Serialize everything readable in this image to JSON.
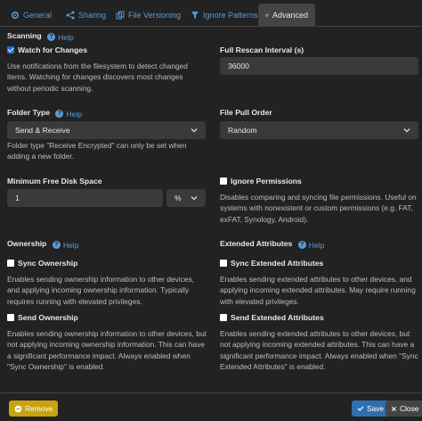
{
  "tabs": [
    {
      "label": "General",
      "icon": "gear-icon"
    },
    {
      "label": "Sharing",
      "icon": "share-icon"
    },
    {
      "label": "File Versioning",
      "icon": "copy-icon"
    },
    {
      "label": "Ignore Patterns",
      "icon": "filter-icon"
    },
    {
      "label": "Advanced",
      "icon": "cogs-icon",
      "active": true
    }
  ],
  "help_label": "Help",
  "scanning": {
    "title": "Scanning",
    "watch_label": "Watch for Changes",
    "watch_checked": true,
    "watch_desc": "Use notifications from the filesystem to detect changed items. Watching for changes discovers most changes without periodic scanning."
  },
  "rescan": {
    "label": "Full Rescan Interval (s)",
    "value": "36000"
  },
  "folder_type": {
    "title": "Folder Type",
    "value": "Send & Receive",
    "desc": "Folder type \"Receive Encrypted\" can only be set when adding a new folder."
  },
  "file_pull_order": {
    "label": "File Pull Order",
    "value": "Random"
  },
  "min_disk": {
    "label": "Minimum Free Disk Space",
    "value": "1",
    "unit": "%"
  },
  "ignore_permissions": {
    "label": "Ignore Permissions",
    "checked": false,
    "desc": "Disables comparing and syncing file permissions. Useful on systems with nonexistent or custom permissions (e.g. FAT, exFAT, Synology, Android)."
  },
  "ownership": {
    "title": "Ownership",
    "sync_label": "Sync Ownership",
    "sync_desc": "Enables sending ownership information to other devices, and applying incoming ownership information. Typically requires running with elevated privileges.",
    "send_label": "Send Ownership",
    "send_desc": "Enables sending ownership information to other devices, but not applying incoming ownership information. This can have a significant performance impact. Always enabled when \"Sync Ownership\" is enabled."
  },
  "xattrs": {
    "title": "Extended Attributes",
    "sync_label": "Sync Extended Attributes",
    "sync_desc": "Enables sending extended attributes to other devices, and applying incoming extended attributes. May require running with elevated privileges.",
    "send_label": "Send Extended Attributes",
    "send_desc": "Enables sending extended attributes to other devices, but not applying incoming extended attributes. This can have a significant performance impact. Always enabled when \"Sync Extended Attributes\" is enabled."
  },
  "footer": {
    "remove_label": "Remove",
    "save_label": "Save",
    "close_label": "Close"
  },
  "colors": {
    "link": "#5b9bd5",
    "warning": "#c8a212",
    "primary": "#2f6fb0",
    "background": "#222222"
  }
}
